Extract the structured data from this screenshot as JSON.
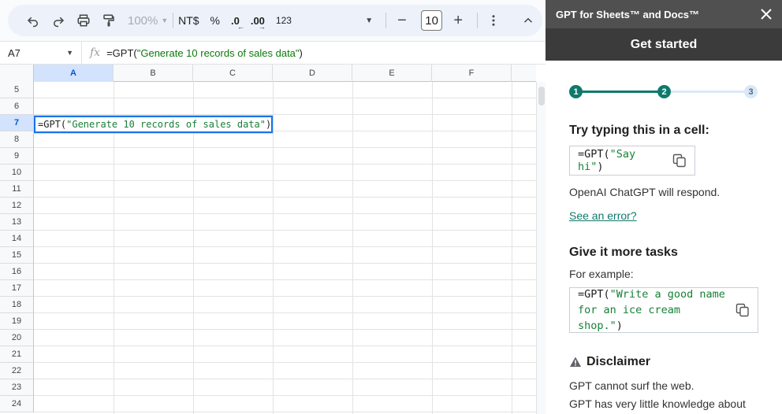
{
  "toolbar": {
    "zoom": "100%",
    "currency": "NT$",
    "percent": "%",
    "decrease_decimal": ".0",
    "increase_decimal": ".00",
    "number_format": "123",
    "font_size": "10"
  },
  "formula_bar": {
    "cell_ref": "A7",
    "fx_label": "fx",
    "formula_prefix": "=GPT(",
    "formula_string": "\"Generate 10 records of sales data\"",
    "formula_suffix": ")"
  },
  "grid": {
    "columns": [
      "A",
      "B",
      "C",
      "D",
      "E",
      "F"
    ],
    "active_column": "A",
    "rows": [
      "5",
      "6",
      "7",
      "8",
      "9",
      "10",
      "11",
      "12",
      "13",
      "14",
      "15",
      "16",
      "17",
      "18",
      "19",
      "20",
      "21",
      "22",
      "23",
      "24"
    ],
    "active_row": "7",
    "active_cell_prefix": "=GPT(",
    "active_cell_string": "\"Generate 10 records of sales data\"",
    "active_cell_suffix": ")"
  },
  "panel": {
    "app_title": "GPT for Sheets™ and Docs™",
    "heading": "Get started",
    "steps": [
      "1",
      "2",
      "3"
    ],
    "current_step": 2,
    "try_title": "Try typing this in a cell:",
    "try_code_prefix": "=GPT(",
    "try_code_string": "\"Say hi\"",
    "try_code_suffix": ")",
    "respond_text": "OpenAI ChatGPT will respond.",
    "error_link": "See an error?",
    "tasks_title": "Give it more tasks",
    "example_label": "For example:",
    "example_line1_prefix": "=GPT(",
    "example_line1_string": "\"Write a good name",
    "example_line2_string": "for an ice cream shop.\"",
    "example_line2_suffix": ")",
    "disclaimer_title": "Disclaimer",
    "disclaimer_line1": "GPT cannot surf the web.",
    "disclaimer_line2": "GPT has very little knowledge about"
  },
  "colors": {
    "accent": "#1a73e8",
    "teal": "#0f7a6c",
    "string_green": "#188038"
  }
}
